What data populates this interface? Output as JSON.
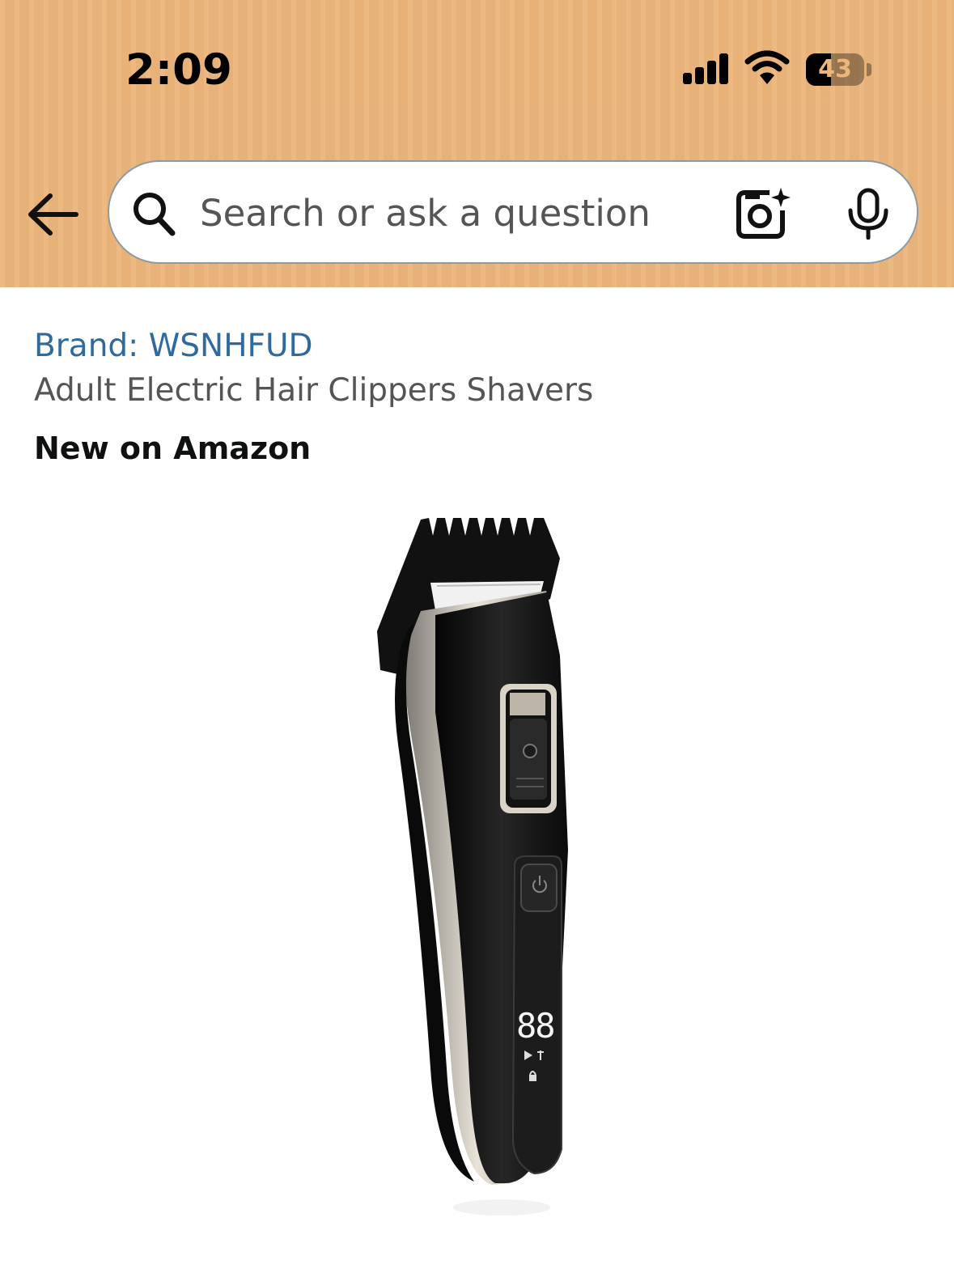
{
  "status_bar": {
    "time": "2:09",
    "battery_percent": "43",
    "battery_level": 0.43
  },
  "search": {
    "placeholder": "Search or ask a question"
  },
  "product": {
    "brand_label": "Brand: WSNHFUD",
    "title": "Adult Electric Hair Clippers Shavers",
    "badge": "New on Amazon",
    "image_alt": "Black and silver electric hair clipper with attached comb guard and LED display",
    "display_digits": "88"
  },
  "colors": {
    "header_bg": "#ebb57b",
    "brand_link": "#2e6a9e",
    "title_text": "#555555"
  },
  "icons": {
    "back": "arrow-left-icon",
    "search": "magnifier-icon",
    "camera": "camera-sparkle-icon",
    "mic": "microphone-icon",
    "signal": "cellular-signal-icon",
    "wifi": "wifi-icon",
    "battery": "battery-icon"
  }
}
